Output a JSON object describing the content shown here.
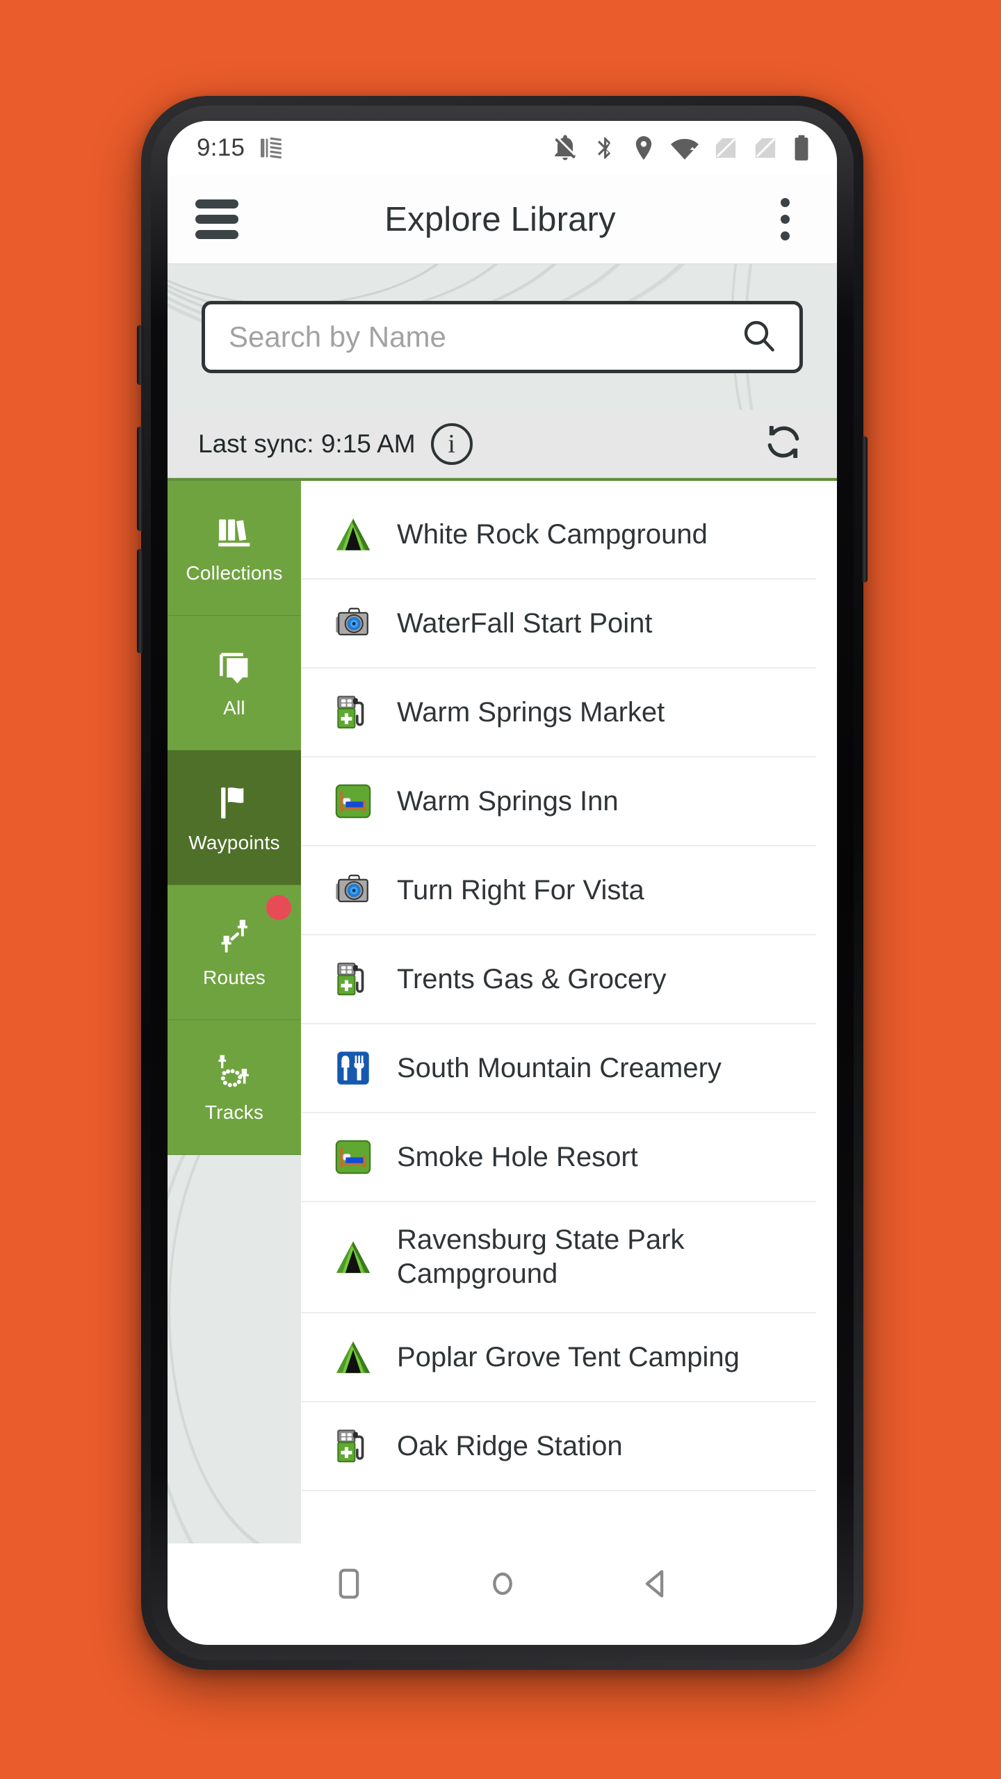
{
  "theme": {
    "page_background": "#ea5c2b",
    "accent_green": "#6fa340",
    "accent_green_selected": "#4e7029",
    "badge_red": "#e74c56",
    "text_dark": "#2f3437"
  },
  "status_bar": {
    "clock": "9:15",
    "left_icons": [
      "vibrate-icon"
    ],
    "right_icons": [
      "notifications-off-icon",
      "bluetooth-icon",
      "location-icon",
      "wifi-icon",
      "no-sim-1-icon",
      "no-sim-2-icon",
      "battery-icon"
    ]
  },
  "app_bar": {
    "menu_label": "menu",
    "title": "Explore Library",
    "overflow_label": "more options"
  },
  "search": {
    "value": "",
    "placeholder": "Search by Name",
    "icon": "search-icon"
  },
  "sync": {
    "text": "Last sync: 9:15 AM",
    "info_glyph": "i",
    "refresh_icon": "refresh-icon"
  },
  "sidebar": {
    "tabs": [
      {
        "label": "Collections",
        "icon": "books-icon",
        "selected": false,
        "badge": false
      },
      {
        "label": "All",
        "icon": "layers-icon",
        "selected": false,
        "badge": false
      },
      {
        "label": "Waypoints",
        "icon": "flag-icon",
        "selected": true,
        "badge": false
      },
      {
        "label": "Routes",
        "icon": "route-icon",
        "selected": false,
        "badge": true
      },
      {
        "label": "Tracks",
        "icon": "track-icon",
        "selected": false,
        "badge": false
      }
    ]
  },
  "list": {
    "partial_row_label": "",
    "items": [
      {
        "label": "White Rock Campground",
        "icon": "campground-icon"
      },
      {
        "label": "WaterFall Start Point",
        "icon": "camera-icon"
      },
      {
        "label": "Warm Springs Market",
        "icon": "gas-station-icon"
      },
      {
        "label": "Warm Springs Inn",
        "icon": "lodging-icon"
      },
      {
        "label": "Turn Right For Vista",
        "icon": "camera-icon"
      },
      {
        "label": "Trents Gas & Grocery",
        "icon": "gas-station-icon"
      },
      {
        "label": "South Mountain Creamery",
        "icon": "restaurant-icon"
      },
      {
        "label": "Smoke Hole Resort",
        "icon": "lodging-icon"
      },
      {
        "label": "Ravensburg State Park Campground",
        "icon": "campground-icon"
      },
      {
        "label": "Poplar Grove Tent Camping",
        "icon": "campground-icon"
      },
      {
        "label": "Oak Ridge Station",
        "icon": "gas-station-icon"
      }
    ]
  },
  "nav_bar": {
    "buttons": [
      {
        "name": "recents",
        "icon": "square-icon"
      },
      {
        "name": "home",
        "icon": "circle-icon"
      },
      {
        "name": "back",
        "icon": "triangle-left-icon"
      }
    ]
  }
}
